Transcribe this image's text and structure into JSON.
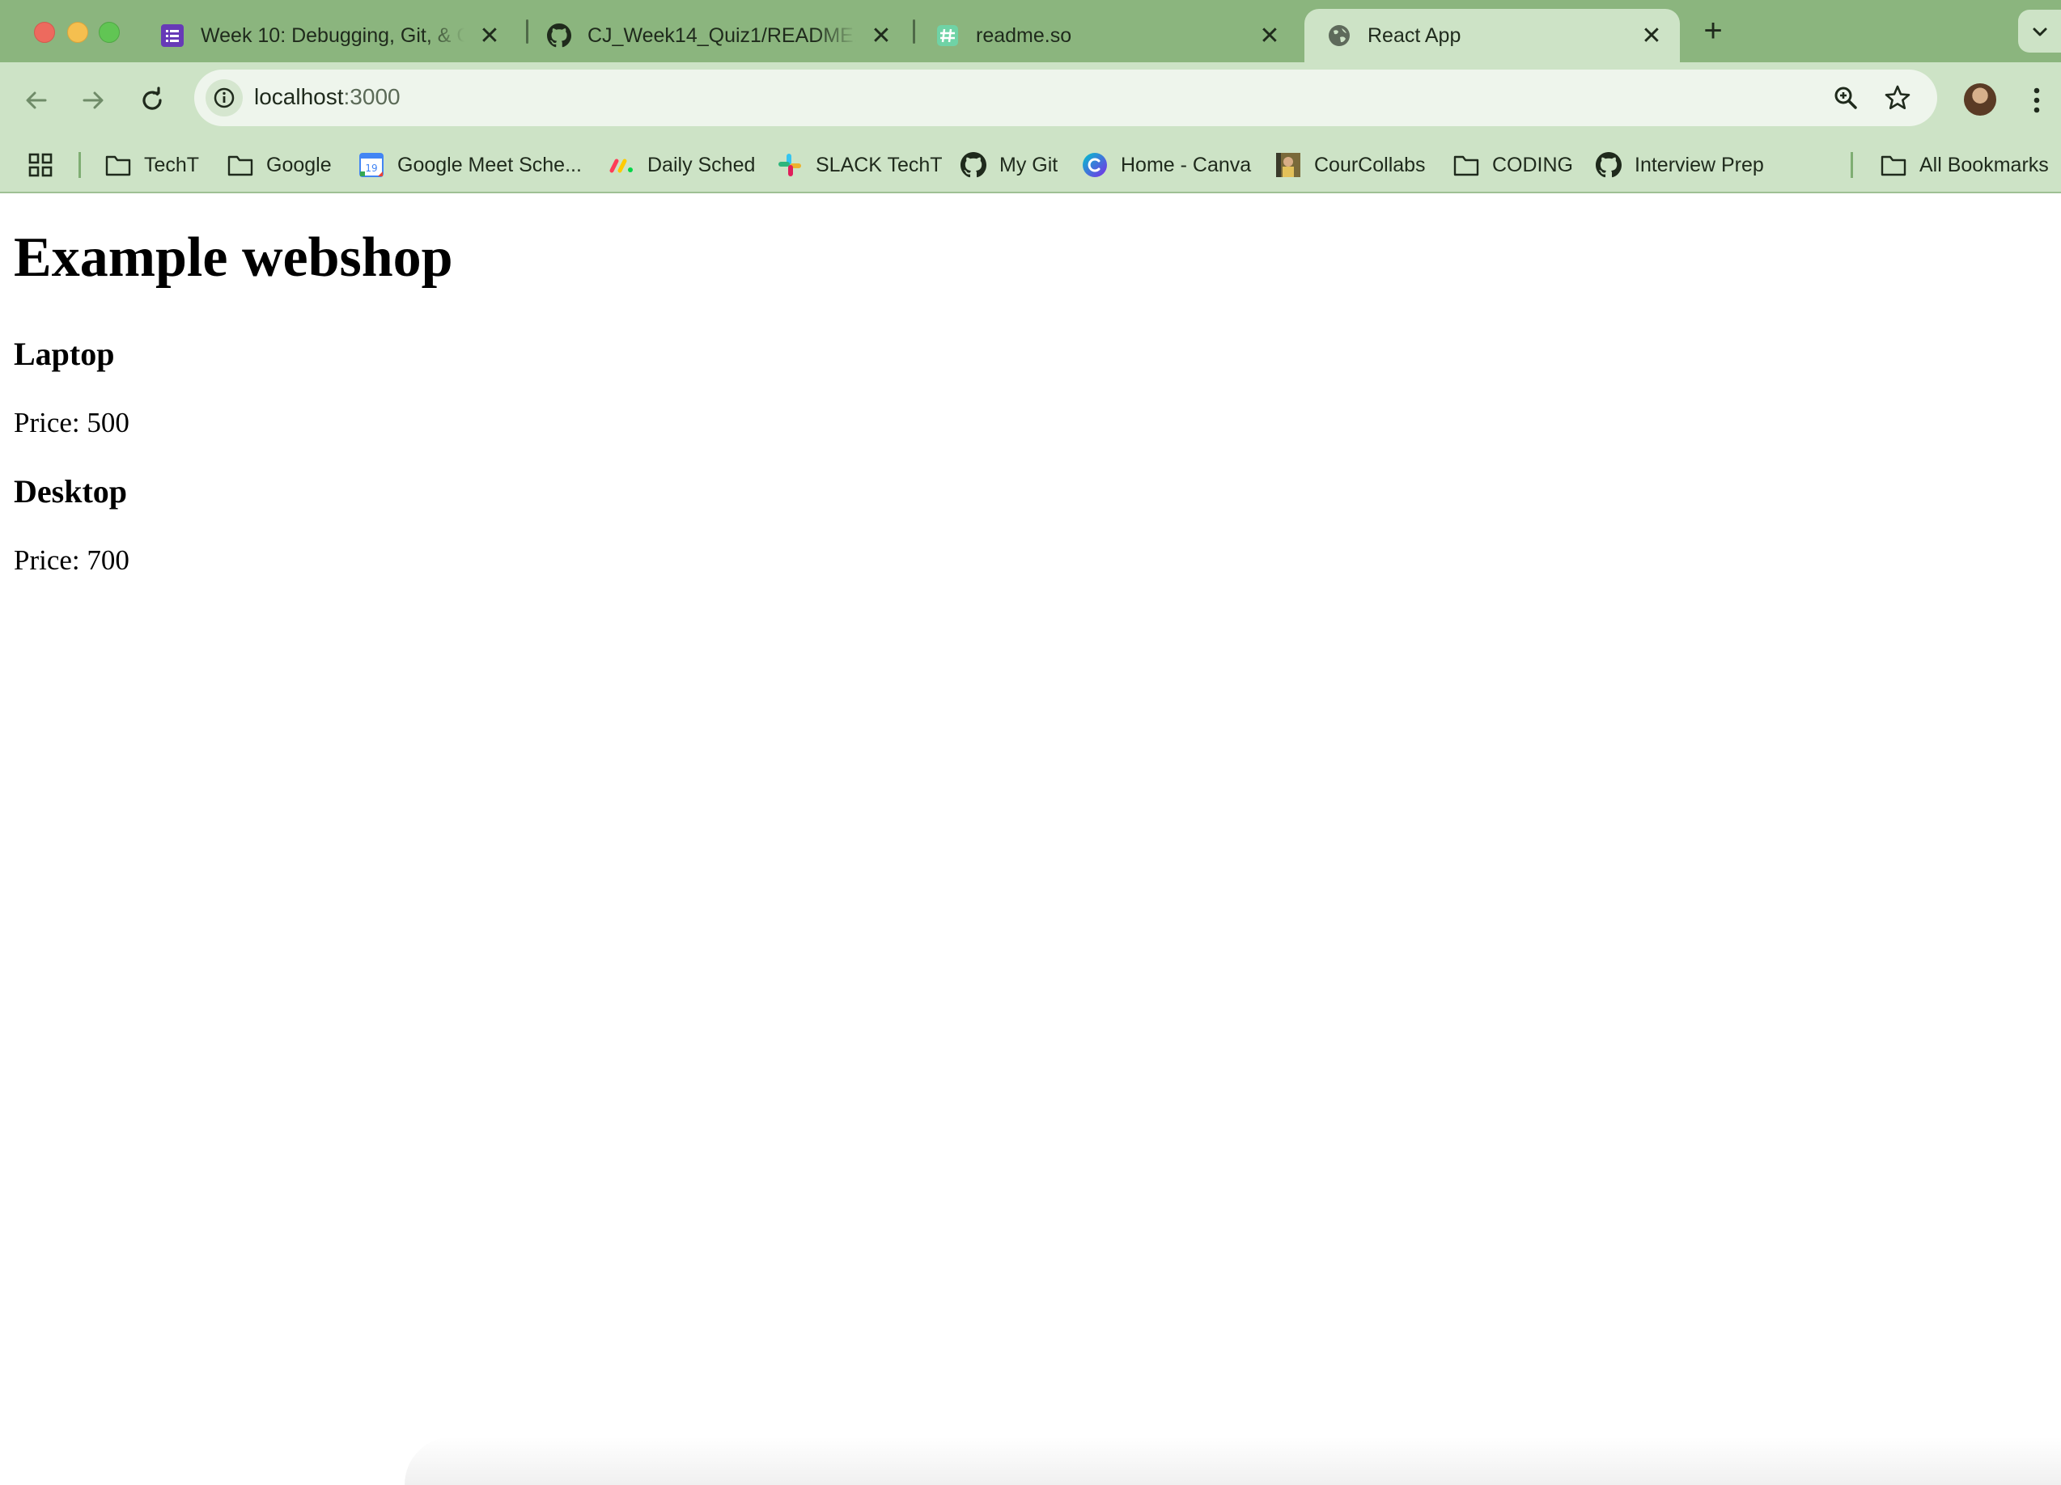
{
  "tabs": [
    {
      "title": "Week 10: Debugging, Git, & G",
      "favicon": "form-icon",
      "active": false
    },
    {
      "title": "CJ_Week14_Quiz1/README.m",
      "favicon": "github-icon",
      "active": false
    },
    {
      "title": "readme.so",
      "favicon": "readme-icon",
      "active": false
    },
    {
      "title": "React App",
      "favicon": "globe-icon",
      "active": true
    }
  ],
  "new_tab": "+",
  "address": {
    "host": "localhost",
    "port": ":3000"
  },
  "bookmarks": [
    {
      "label": "TechT",
      "icon": "folder-icon"
    },
    {
      "label": "Google",
      "icon": "folder-icon"
    },
    {
      "label": "Google Meet Sche...",
      "icon": "calendar-icon"
    },
    {
      "label": "Daily Sched",
      "icon": "monday-icon"
    },
    {
      "label": "SLACK TechT",
      "icon": "slack-icon"
    },
    {
      "label": "My Git",
      "icon": "github-icon"
    },
    {
      "label": "Home - Canva",
      "icon": "canva-icon"
    },
    {
      "label": "CourCollabs",
      "icon": "photo-icon"
    },
    {
      "label": "CODING",
      "icon": "folder-icon"
    },
    {
      "label": "Interview Prep",
      "icon": "github-icon"
    }
  ],
  "all_bookmarks": "All Bookmarks",
  "calendar_day": "19",
  "page": {
    "heading": "Example webshop",
    "products": [
      {
        "name": "Laptop",
        "price": "Price: 500"
      },
      {
        "name": "Desktop",
        "price": "Price: 700"
      }
    ]
  },
  "colors": {
    "tabstrip": "#8bb57e",
    "toolbar": "#cde3c6",
    "omnibox": "#eef5ec"
  }
}
